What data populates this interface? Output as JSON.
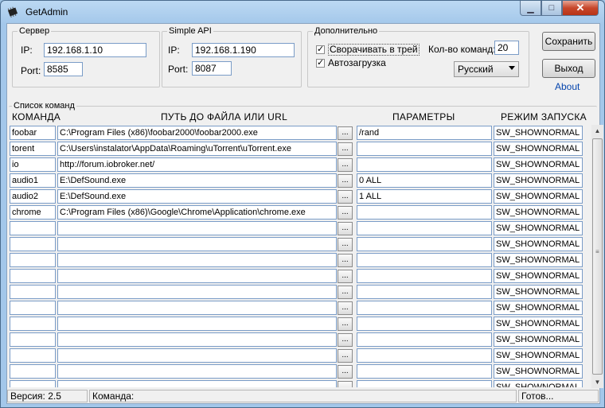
{
  "window": {
    "title": "GetAdmin"
  },
  "server": {
    "legend": "Сервер",
    "ip_label": "IP:",
    "ip": "192.168.1.10",
    "port_label": "Port:",
    "port": "8585"
  },
  "simple_api": {
    "legend": "Simple API",
    "ip_label": "IP:",
    "ip": "192.168.1.190",
    "port_label": "Port:",
    "port": "8087"
  },
  "extra": {
    "legend": "Дополнительно",
    "minimize_tray": {
      "label": "Сворачивать в трей",
      "checked": true
    },
    "autostart": {
      "label": "Автозагрузка",
      "checked": true
    },
    "commands_count_label": "Кол-во команд:",
    "commands_count": "20",
    "language": "Русский"
  },
  "buttons": {
    "save": "Сохранить",
    "exit": "Выход",
    "about": "About"
  },
  "commands": {
    "legend": "Список команд",
    "headers": {
      "command": "КОМАНДА",
      "path": "ПУТЬ ДО ФАЙЛА ИЛИ URL",
      "params": "ПАРАМЕТРЫ",
      "mode": "РЕЖИМ ЗАПУСКА"
    },
    "browse_label": "...",
    "rows": [
      {
        "command": "foobar",
        "path": "C:\\Program Files (x86)\\foobar2000\\foobar2000.exe",
        "params": "/rand",
        "mode": "SW_SHOWNORMAL"
      },
      {
        "command": "torent",
        "path": "C:\\Users\\instalator\\AppData\\Roaming\\uTorrent\\uTorrent.exe",
        "params": "",
        "mode": "SW_SHOWNORMAL"
      },
      {
        "command": "io",
        "path": "http://forum.iobroker.net/",
        "params": "",
        "mode": "SW_SHOWNORMAL"
      },
      {
        "command": "audio1",
        "path": "E:\\DefSound.exe",
        "params": "0 ALL",
        "mode": "SW_SHOWNORMAL"
      },
      {
        "command": "audio2",
        "path": "E:\\DefSound.exe",
        "params": "1 ALL",
        "mode": "SW_SHOWNORMAL"
      },
      {
        "command": "chrome",
        "path": "C:\\Program Files (x86)\\Google\\Chrome\\Application\\chrome.exe",
        "params": "",
        "mode": "SW_SHOWNORMAL"
      },
      {
        "command": "",
        "path": "",
        "params": "",
        "mode": "SW_SHOWNORMAL"
      },
      {
        "command": "",
        "path": "",
        "params": "",
        "mode": "SW_SHOWNORMAL"
      },
      {
        "command": "",
        "path": "",
        "params": "",
        "mode": "SW_SHOWNORMAL"
      },
      {
        "command": "",
        "path": "",
        "params": "",
        "mode": "SW_SHOWNORMAL"
      },
      {
        "command": "",
        "path": "",
        "params": "",
        "mode": "SW_SHOWNORMAL"
      },
      {
        "command": "",
        "path": "",
        "params": "",
        "mode": "SW_SHOWNORMAL"
      },
      {
        "command": "",
        "path": "",
        "params": "",
        "mode": "SW_SHOWNORMAL"
      },
      {
        "command": "",
        "path": "",
        "params": "",
        "mode": "SW_SHOWNORMAL"
      },
      {
        "command": "",
        "path": "",
        "params": "",
        "mode": "SW_SHOWNORMAL"
      },
      {
        "command": "",
        "path": "",
        "params": "",
        "mode": "SW_SHOWNORMAL"
      },
      {
        "command": "",
        "path": "",
        "params": "",
        "mode": "SW_SHOWNORMAL"
      }
    ]
  },
  "status": {
    "version": "Версия: 2.5",
    "command": "Команда:",
    "state": "Готов..."
  }
}
